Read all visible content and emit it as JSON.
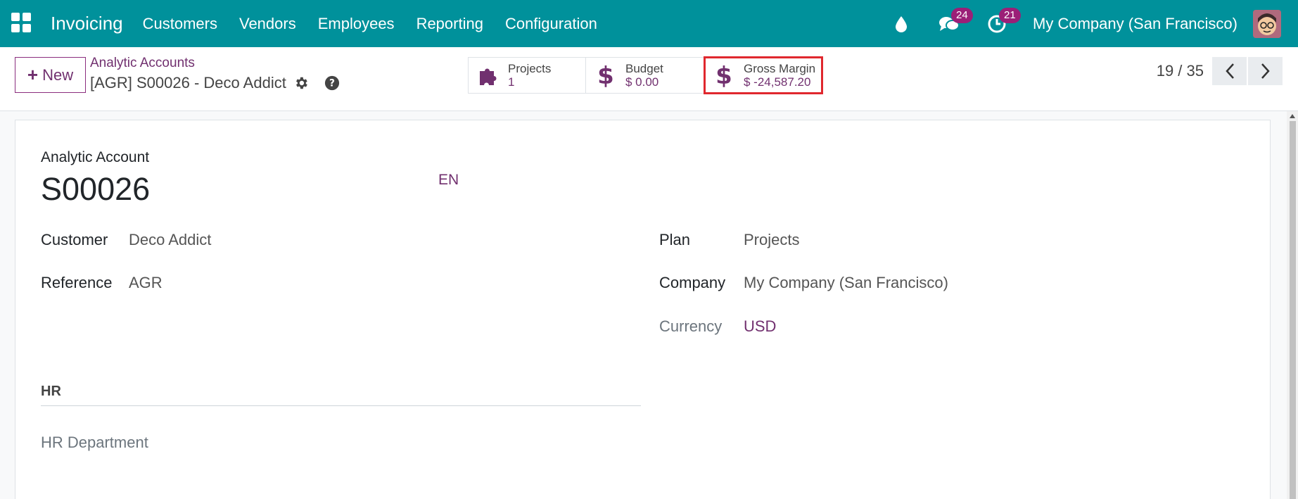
{
  "navbar": {
    "app_name": "Invoicing",
    "menu": [
      "Customers",
      "Vendors",
      "Employees",
      "Reporting",
      "Configuration"
    ],
    "messages_count": "24",
    "activities_count": "21",
    "company": "My Company (San Francisco)"
  },
  "control": {
    "new_label": "New",
    "breadcrumb_parent": "Analytic Accounts",
    "breadcrumb_current": "[AGR] S00026 - Deco Addict",
    "smart_buttons": [
      {
        "label": "Projects",
        "value": "1",
        "icon": "puzzle-icon"
      },
      {
        "label": "Budget",
        "value": "$ 0.00",
        "icon": "dollar-icon"
      },
      {
        "label": "Gross Margin",
        "value": "$ -24,587.20",
        "icon": "dollar-icon"
      }
    ],
    "pager": "19 / 35"
  },
  "form": {
    "title_label": "Analytic Account",
    "name": "S00026",
    "lang": "EN",
    "customer_label": "Customer",
    "customer_value": "Deco Addict",
    "reference_label": "Reference",
    "reference_value": "AGR",
    "plan_label": "Plan",
    "plan_value": "Projects",
    "company_label": "Company",
    "company_value": "My Company (San Francisco)",
    "currency_label": "Currency",
    "currency_value": "USD",
    "hr_section": "HR",
    "hr_department_label": "HR Department"
  },
  "colors": {
    "navbar": "#00919b",
    "accent": "#71306f",
    "highlight": "#e0282e"
  }
}
